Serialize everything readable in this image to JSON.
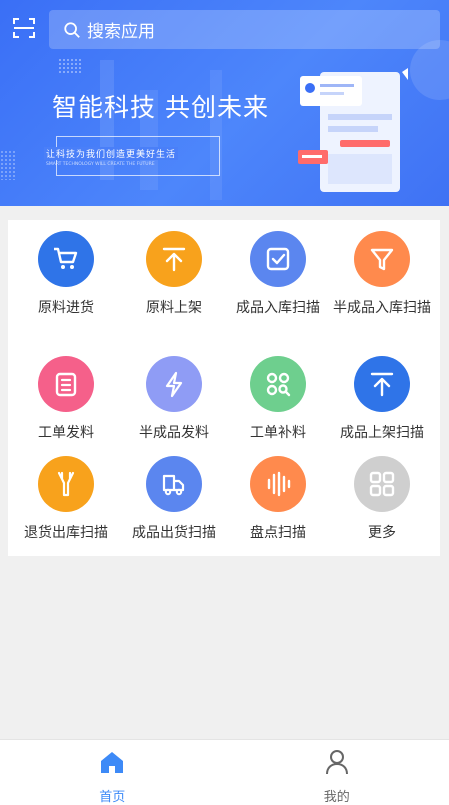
{
  "search": {
    "placeholder": "搜索应用"
  },
  "banner": {
    "title": "智能科技 共创未来",
    "subtitle": "让科技为我们创造更美好生活",
    "subtitle_en": "SMART TECHNOLOGY WILL CREATE THE FUTURE"
  },
  "apps": [
    {
      "label": "原料进货",
      "icon": "cart-icon",
      "color": "#2f74e8"
    },
    {
      "label": "原料上架",
      "icon": "upload-top-icon",
      "color": "#f8a21c"
    },
    {
      "label": "成品入库扫描",
      "icon": "checkbox-icon",
      "color": "#5b86ef"
    },
    {
      "label": "半成品入库扫描",
      "icon": "filter-icon",
      "color": "#ff8a4d"
    },
    {
      "label": "工单发料",
      "icon": "document-icon",
      "color": "#f5608a"
    },
    {
      "label": "半成品发料",
      "icon": "lightning-icon",
      "color": "#8f9cf5"
    },
    {
      "label": "工单补料",
      "icon": "circles-search-icon",
      "color": "#6ecf8e"
    },
    {
      "label": "成品上架扫描",
      "icon": "upload-top-icon",
      "color": "#2f74e8"
    },
    {
      "label": "退货出库扫描",
      "icon": "funnel-return-icon",
      "color": "#f8a21c"
    },
    {
      "label": "成品出货扫描",
      "icon": "truck-icon",
      "color": "#5b86ef"
    },
    {
      "label": "盘点扫描",
      "icon": "bars-icon",
      "color": "#ff8a4d"
    },
    {
      "label": "更多",
      "icon": "grid-more-icon",
      "color": "#cfcfcf"
    }
  ],
  "tabs": [
    {
      "label": "首页",
      "icon": "home-icon",
      "active": true,
      "color": "#3d8af7"
    },
    {
      "label": "我的",
      "icon": "user-icon",
      "active": false,
      "color": "#666666"
    }
  ]
}
